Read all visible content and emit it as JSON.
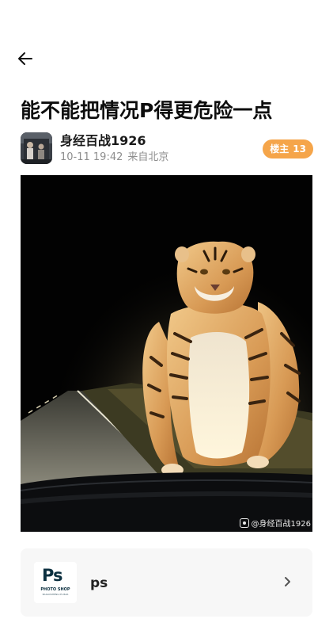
{
  "header": {
    "back_icon": "arrow-left-icon"
  },
  "post": {
    "title": "能不能把情况P得更危险一点",
    "author": {
      "name": "身经百战1926",
      "date": "10-11 19:42",
      "location": "来自北京"
    },
    "floor_badge": {
      "label": "楼主",
      "count": "13"
    },
    "image": {
      "watermark": "@身经百战1926"
    }
  },
  "app_card": {
    "icon_label": "Ps",
    "icon_caption": "PHOTO SHOP",
    "icon_subcaption": "BAIGUISHENG PS BAR",
    "name": "ps",
    "chevron_icon": "chevron-right-icon"
  },
  "colors": {
    "badge": "#f5a54a",
    "card_bg": "#f7f7f7",
    "meta_text": "#8e8e8e"
  }
}
